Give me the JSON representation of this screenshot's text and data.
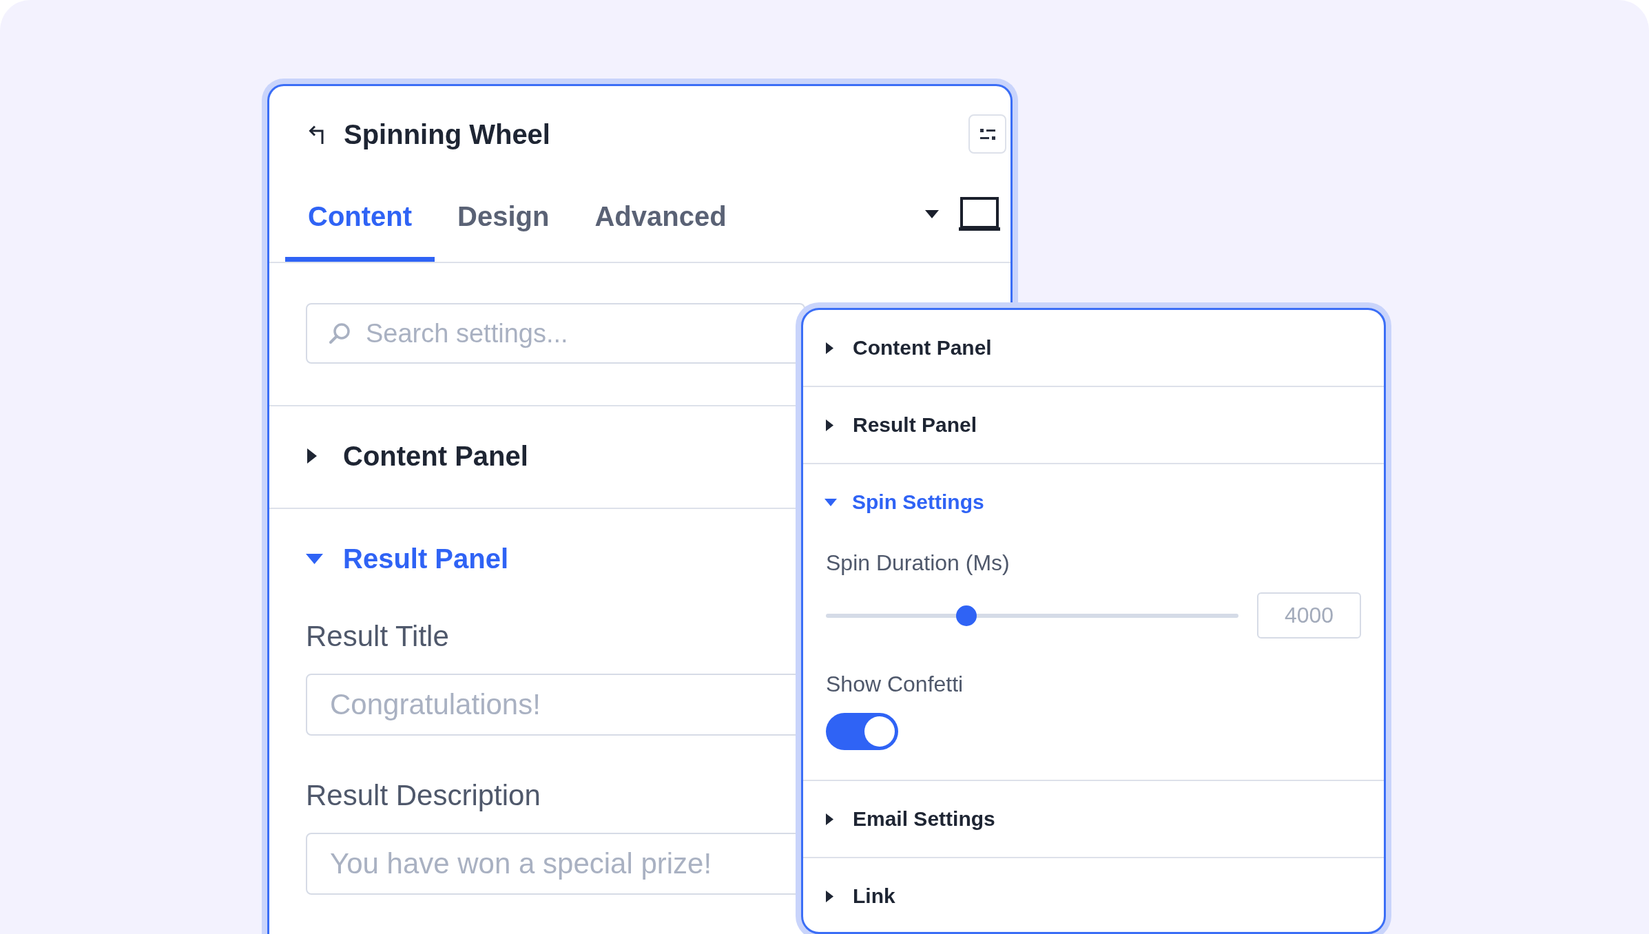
{
  "editor": {
    "title": "Spinning Wheel",
    "tabs": [
      {
        "label": "Content",
        "selected": true
      },
      {
        "label": "Design",
        "selected": false
      },
      {
        "label": "Advanced",
        "selected": false
      }
    ],
    "search": {
      "placeholder": "Search settings..."
    },
    "sections": [
      {
        "title": "Content Panel",
        "expanded": false
      },
      {
        "title": "Result Panel",
        "expanded": true,
        "fields": [
          {
            "label": "Result Title",
            "placeholder": "Congratulations!"
          },
          {
            "label": "Result Description",
            "placeholder": "You have won a special prize!"
          }
        ]
      }
    ]
  },
  "settings_popup": {
    "sections": [
      {
        "title": "Content Panel",
        "expanded": false
      },
      {
        "title": "Result Panel",
        "expanded": false
      },
      {
        "title": "Spin Settings",
        "expanded": true,
        "controls": [
          {
            "kind": "slider",
            "label": "Spin Duration (Ms)",
            "level": 0.34,
            "value": "4000"
          },
          {
            "kind": "toggle",
            "label": "Show Confetti",
            "on": true
          }
        ]
      },
      {
        "title": "Email Settings",
        "expanded": false
      },
      {
        "title": "Link",
        "expanded": false
      }
    ]
  }
}
